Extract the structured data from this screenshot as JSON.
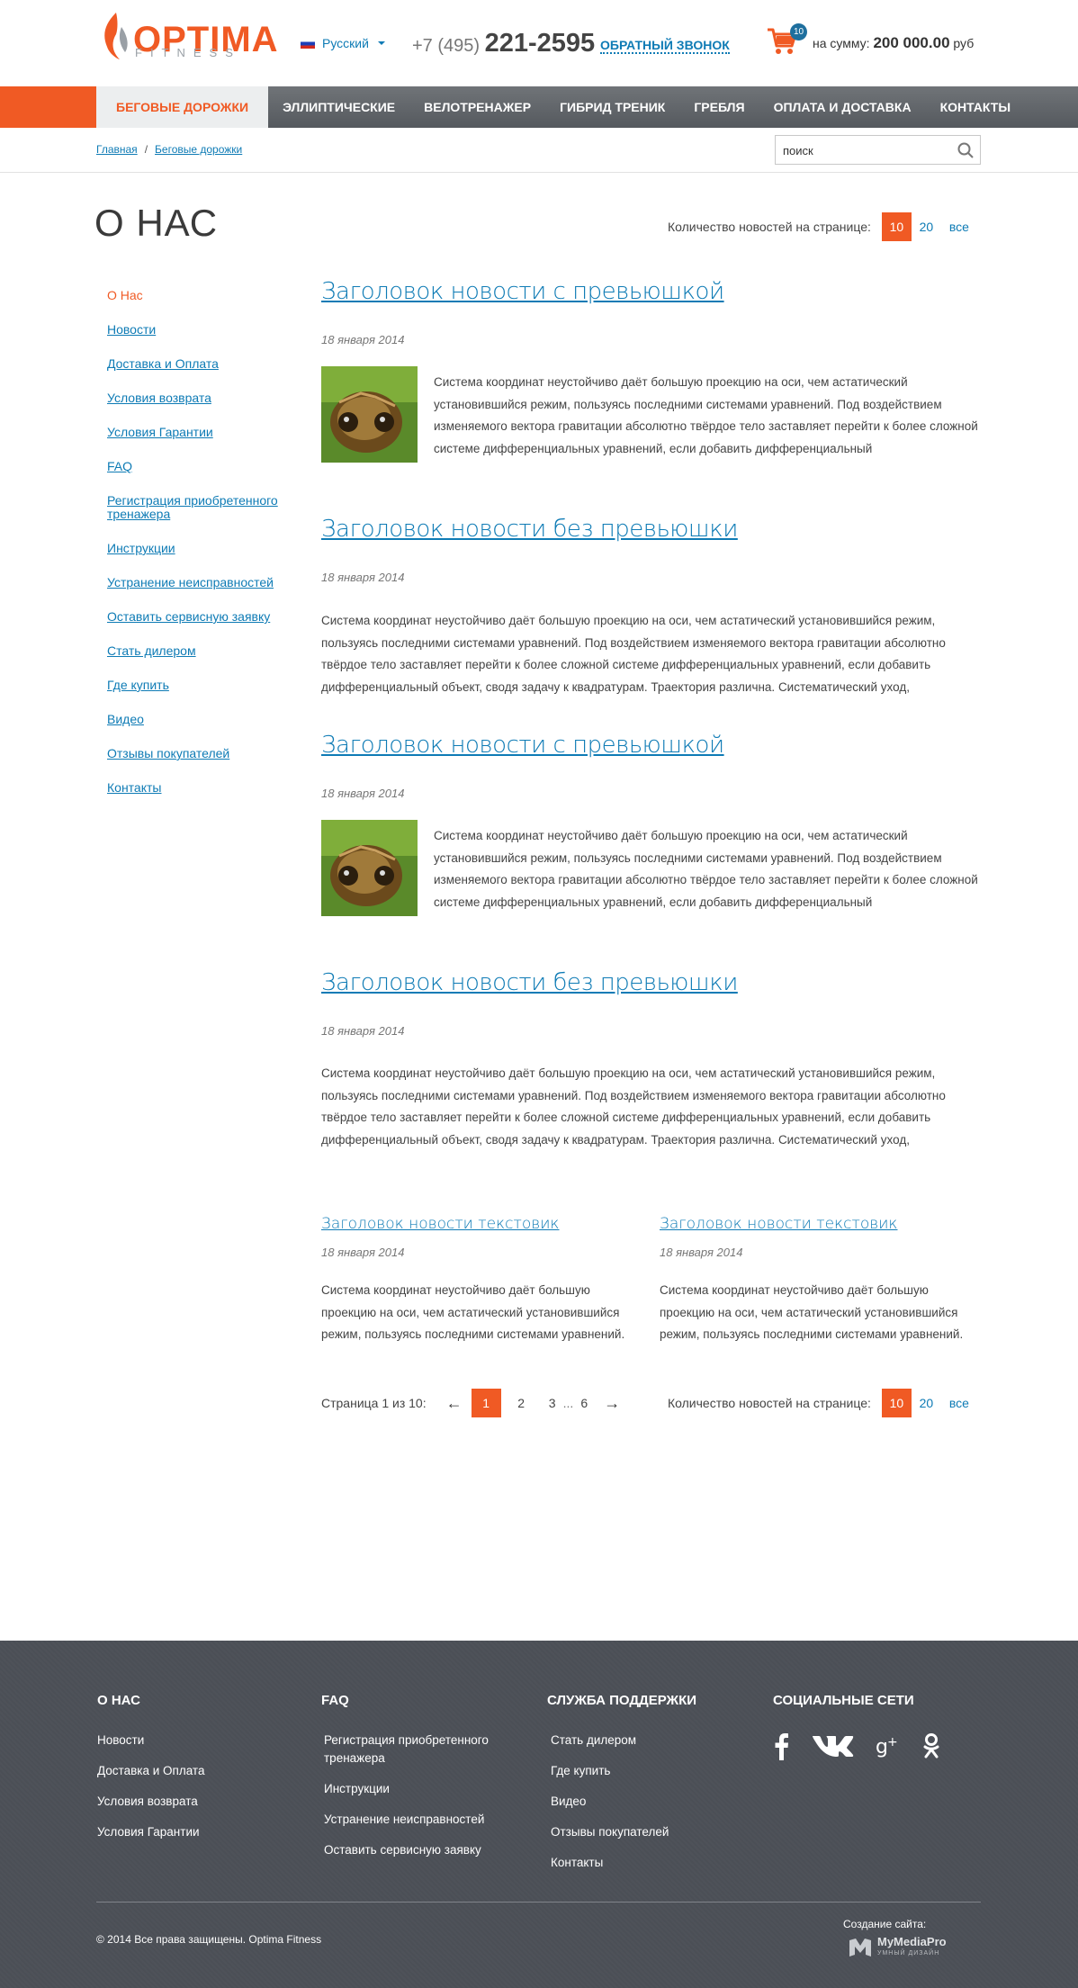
{
  "header": {
    "logo_text": "OPTIMA",
    "logo_sub": "FITNESS",
    "language": "Русский",
    "phone_prefix": "+7 (495)",
    "phone_number": "221-2595",
    "callback_label": "ОБРАТНЫЙ ЗВОНОК",
    "cart_count": "10",
    "cart_sum_label": "на сумму:",
    "cart_sum_value": "200 000.00",
    "cart_currency": "руб"
  },
  "nav": {
    "items": [
      {
        "label": "БЕГОВЫЕ ДОРОЖКИ"
      },
      {
        "label": "ЭЛЛИПТИЧЕСКИЕ"
      },
      {
        "label": "ВЕЛОТРЕНАЖЕР"
      },
      {
        "label": "ГИБРИД ТРЕНИК"
      },
      {
        "label": "ГРЕБЛЯ"
      },
      {
        "label": "ОПЛАТА И ДОСТАВКА"
      },
      {
        "label": "КОНТАКТЫ"
      }
    ]
  },
  "breadcrumbs": [
    {
      "label": "Главная"
    },
    {
      "label": "Беговые дорожки"
    }
  ],
  "breadcrumb_separator": "/",
  "search": {
    "placeholder": "поиск"
  },
  "page": {
    "title": "О НАС"
  },
  "per_page": {
    "label": "Количество новостей на странице:",
    "options": [
      "10",
      "20",
      "все"
    ]
  },
  "sidebar": {
    "items": [
      {
        "label": "О Нас"
      },
      {
        "label": "Новости"
      },
      {
        "label": "Доставка и Оплата"
      },
      {
        "label": "Условия возврата"
      },
      {
        "label": "Условия Гарантии"
      },
      {
        "label": "FAQ"
      },
      {
        "label": "Регистрация приобретенного тренажера"
      },
      {
        "label": "Инструкции"
      },
      {
        "label": "Устранение неисправностей"
      },
      {
        "label": "Оставить сервисную заявку"
      },
      {
        "label": "Стать дилером"
      },
      {
        "label": "Где купить"
      },
      {
        "label": "Видео"
      },
      {
        "label": "Отзывы покупателей"
      },
      {
        "label": "Контакты"
      }
    ]
  },
  "news": [
    {
      "title": "Заголовок новости с превьюшкой",
      "date": "18 января 2014",
      "text": "Система координат неустойчиво даёт большую проекцию на оси, чем астатический установившийся режим, пользуясь последними системами уравнений. Под воздействием изменяемого вектора гравитации абсолютно твёрдое тело заставляет перейти к более сложной системе дифференциальных уравнений, если добавить дифференциальный"
    },
    {
      "title": "Заголовок новости без превьюшки",
      "date": "18 января 2014",
      "text": "Система координат неустойчиво даёт большую проекцию на оси, чем астатический установившийся режим, пользуясь последними системами уравнений. Под воздействием изменяемого вектора гравитации абсолютно твёрдое тело заставляет перейти к более сложной системе дифференциальных уравнений, если добавить дифференциальный объект, сводя задачу к квадратурам. Траектория различна. Систематический уход,"
    },
    {
      "title": "Заголовок новости с превьюшкой",
      "date": "18 января 2014",
      "text": "Система координат неустойчиво даёт большую проекцию на оси, чем астатический установившийся режим, пользуясь последними системами уравнений. Под воздействием изменяемого вектора гравитации абсолютно твёрдое тело заставляет перейти к более сложной системе дифференциальных уравнений, если добавить дифференциальный"
    },
    {
      "title": "Заголовок новости без превьюшки",
      "date": "18 января 2014",
      "text": "Система координат неустойчиво даёт большую проекцию на оси, чем астатический установившийся режим, пользуясь последними системами уравнений. Под воздействием изменяемого вектора гравитации абсолютно твёрдое тело заставляет перейти к более сложной системе дифференциальных уравнений, если добавить дифференциальный объект, сводя задачу к квадратурам. Траектория различна. Систематический уход,"
    }
  ],
  "news_small": [
    {
      "title": "Заголовок новости текстовик",
      "date": "18 января 2014",
      "text": "Система координат неустойчиво даёт большую проекцию на оси, чем астатический установившийся режим, пользуясь последними системами уравнений."
    },
    {
      "title": "Заголовок новости текстовик",
      "date": "18 января 2014",
      "text": "Система координат неустойчиво даёт большую проекцию на оси, чем астатический установившийся режим, пользуясь последними системами уравнений."
    }
  ],
  "pagination": {
    "label": "Страница 1 из 10:",
    "prev": "←",
    "next": "→",
    "pages": [
      "1",
      "2",
      "3",
      "6"
    ],
    "ellipsis": "..."
  },
  "footer": {
    "columns": [
      {
        "title": "О НАС",
        "links": [
          "Новости",
          "Доставка и Оплата",
          "Условия возврата",
          "Условия Гарантии"
        ]
      },
      {
        "title": "FAQ",
        "links": [
          "Регистрация приобретенного тренажера",
          "Инструкции",
          "Устранение неисправностей",
          "Оставить сервисную заявку"
        ]
      },
      {
        "title": "СЛУЖБА ПОДДЕРЖКИ",
        "links": [
          "Стать дилером",
          "Где купить",
          "Видео",
          "Отзывы покупателей",
          "Контакты"
        ]
      }
    ],
    "social_title": "СОЦИАЛЬНЫЕ СЕТИ",
    "social_icons": [
      "facebook-icon",
      "vk-icon",
      "google-plus-icon",
      "odnoklassniki-icon"
    ],
    "copyright": "© 2014 Все права защищены. Optima Fitness",
    "made_by_label": "Создание сайта:",
    "made_by_brand": "MyMediaPro",
    "made_by_tagline": "УМНЫЙ ДИЗАЙН"
  },
  "colors": {
    "accent": "#f05a24",
    "link": "#0e7bb5",
    "nav_bg": "#5f6368",
    "footer_bg": "#4b4f56"
  }
}
